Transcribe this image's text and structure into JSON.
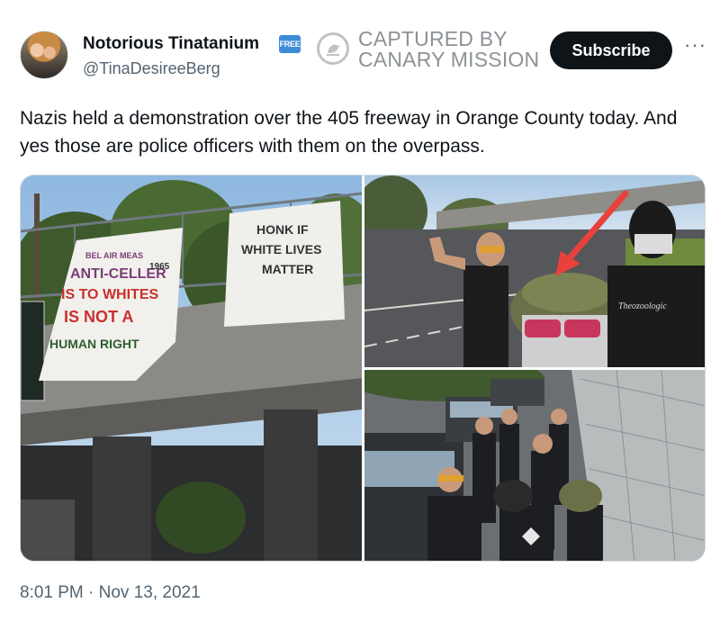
{
  "author": {
    "display_name": "Notorious Tinatanium",
    "badge": "FREE",
    "handle": "@TinaDesireeBerg"
  },
  "watermark": {
    "line1": "CAPTURED BY",
    "line2": "CANARY MISSION"
  },
  "actions": {
    "subscribe_label": "Subscribe",
    "more_label": "···"
  },
  "tweet": {
    "text": "Nazis held a demonstration over the 405 freeway in Orange County today. And yes those are police officers with them on the overpass.",
    "timestamp": "8:01 PM · Nov 13, 2021"
  },
  "media": {
    "banner_left": {
      "line1": "BEL AIR MEAS",
      "line2": "ANTI-CELLER",
      "line3": "1965",
      "line4": "IS TO WHITES",
      "line5": "IS NOT A",
      "line6": "HUMAN RIGHT"
    },
    "banner_right": {
      "line1": "HONK IF",
      "line2": "WHITE LIVES",
      "line3": "MATTER"
    },
    "shirt_text": "Theozoologic"
  },
  "colors": {
    "subscribe_bg": "#0f1419",
    "badge_bg": "#3d8bd9",
    "watermark_text": "#8d9296",
    "secondary_text": "#536471",
    "arrow": "#e8413c"
  }
}
